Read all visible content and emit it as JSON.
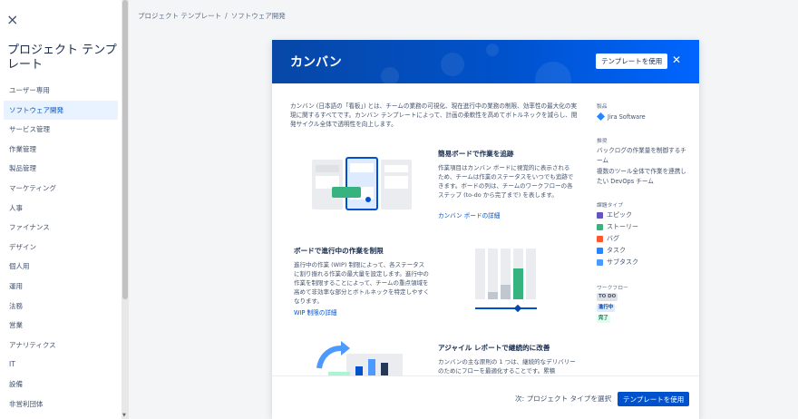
{
  "sidebar": {
    "close_glyph": "×",
    "title": "プロジェクト テンプレート",
    "items": [
      {
        "label": "ユーザー専用",
        "active": false
      },
      {
        "label": "ソフトウェア開発",
        "active": true
      },
      {
        "label": "サービス管理",
        "active": false
      },
      {
        "label": "作業管理",
        "active": false
      },
      {
        "label": "製品管理",
        "active": false
      },
      {
        "label": "マーケティング",
        "active": false
      },
      {
        "label": "人事",
        "active": false
      },
      {
        "label": "ファイナンス",
        "active": false
      },
      {
        "label": "デザイン",
        "active": false
      },
      {
        "label": "個人用",
        "active": false
      },
      {
        "label": "運用",
        "active": false
      },
      {
        "label": "法務",
        "active": false
      },
      {
        "label": "営業",
        "active": false
      },
      {
        "label": "アナリティクス",
        "active": false
      },
      {
        "label": "IT",
        "active": false
      },
      {
        "label": "設備",
        "active": false
      },
      {
        "label": "非営利団体",
        "active": false
      }
    ]
  },
  "breadcrumb": {
    "root": "プロジェクト テンプレート",
    "separator": "/",
    "current": "ソフトウェア開発"
  },
  "modal": {
    "title": "カンバン",
    "use_template_label": "テンプレートを使用",
    "close_glyph": "✕",
    "description": "カンバン (日本語の「看板」) とは、チームの業務の可視化、現在進行中の業務の制限、効率性の最大化の実現に関するすべてです。カンバン テンプレートによって、計画の柔軟性を高めてボトルネックを減らし、開発サイクル全体で透明性を向上します。",
    "sections": [
      {
        "title": "簡易ボードで作業を追跡",
        "text": "作業項目はカンバン ボードに視覚的に表示されるため、チームは作業のステータスをいつでも追跡できます。ボードの列は、チームのワークフローの各ステップ (to-do から完了まで) を表します。",
        "link": "カンバン ボードの詳細"
      },
      {
        "title": "ボードで進行中の作業を制限",
        "text": "進行中の作業 (WIP) 制限によって、各ステータスに割り振れる作業の最大量を設定します。進行中の作業を制限することによって、チームの重点領域を高めて非効率な部分とボトルネックを特定しやすくなります。",
        "link": "WIP 制限の詳細"
      },
      {
        "title": "アジャイル レポートで継続的に改善",
        "text": "カンバンの主な原則の 1 つは、継続的なデリバリーのためにフローを最適化することです。累積"
      }
    ],
    "side": {
      "product_label": "製品",
      "product_name": "Jira Software",
      "recommended_label": "推奨",
      "recommended_1": "バックログの作業量を制御するチーム",
      "recommended_2": "複数のツール全体で作業を連携したい DevOps チーム",
      "issue_types_label": "課題タイプ",
      "issue_types": [
        {
          "label": "エピック",
          "color": "#6554c0",
          "icon": "epic-icon"
        },
        {
          "label": "ストーリー",
          "color": "#36b37e",
          "icon": "story-icon"
        },
        {
          "label": "バグ",
          "color": "#ff5630",
          "icon": "bug-icon"
        },
        {
          "label": "タスク",
          "color": "#2684ff",
          "icon": "task-icon"
        },
        {
          "label": "サブタスク",
          "color": "#4c9aff",
          "icon": "subtask-icon"
        }
      ],
      "workflow_label": "ワークフロー",
      "workflow": [
        {
          "label": "TO DO",
          "bg": "#dfe1e6",
          "fg": "#42526e"
        },
        {
          "label": "進行中",
          "bg": "#deebff",
          "fg": "#0747a6"
        },
        {
          "label": "完了",
          "bg": "#e3fcef",
          "fg": "#006644"
        }
      ]
    }
  },
  "footer": {
    "next_label": "次: プロジェクト タイプを選択",
    "use_template_label": "テンプレートを使用"
  }
}
